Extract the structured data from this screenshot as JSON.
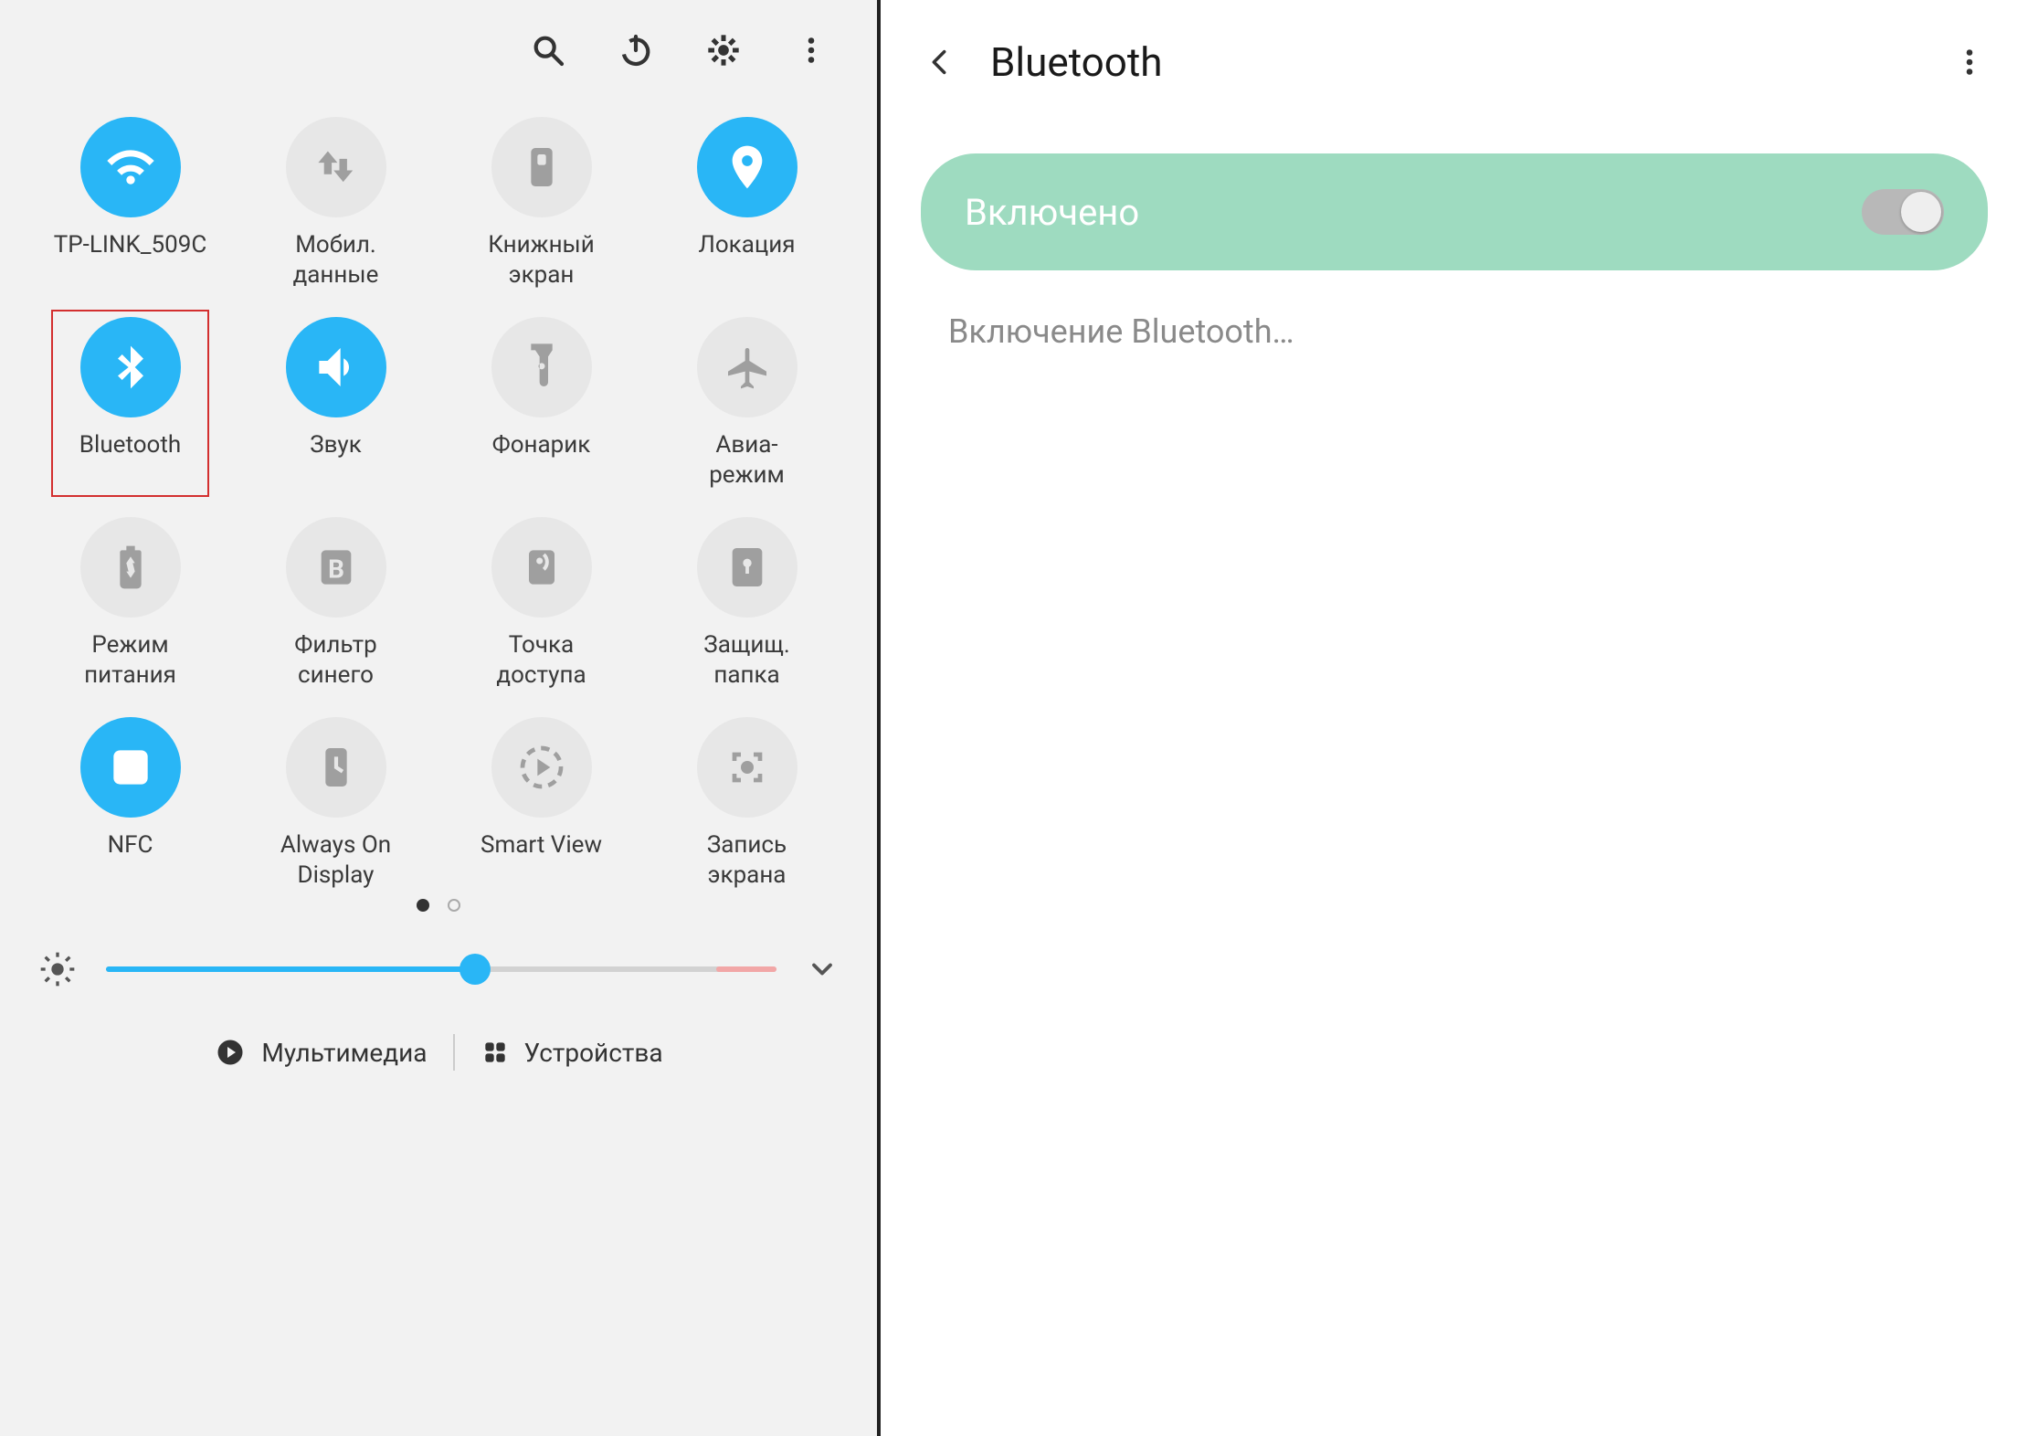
{
  "quick_settings": {
    "tiles": [
      {
        "label": "TP-LINK_509C",
        "icon": "wifi-icon",
        "active": true,
        "highlight": false
      },
      {
        "label": "Мобил.\nданные",
        "icon": "mobile-data-icon",
        "active": false,
        "highlight": false
      },
      {
        "label": "Книжный\nэкран",
        "icon": "book-screen-icon",
        "active": false,
        "highlight": false
      },
      {
        "label": "Локация",
        "icon": "location-icon",
        "active": true,
        "highlight": false
      },
      {
        "label": "Bluetooth",
        "icon": "bluetooth-icon",
        "active": true,
        "highlight": true
      },
      {
        "label": "Звук",
        "icon": "sound-icon",
        "active": true,
        "highlight": false
      },
      {
        "label": "Фонарик",
        "icon": "flashlight-icon",
        "active": false,
        "highlight": false
      },
      {
        "label": "Авиа-\nрежим",
        "icon": "airplane-icon",
        "active": false,
        "highlight": false
      },
      {
        "label": "Режим\nпитания",
        "icon": "battery-saver-icon",
        "active": false,
        "highlight": false
      },
      {
        "label": "Фильтр\nсинего",
        "icon": "blue-light-icon",
        "active": false,
        "highlight": false
      },
      {
        "label": "Точка\nдоступа",
        "icon": "hotspot-icon",
        "active": false,
        "highlight": false
      },
      {
        "label": "Защищ.\nпапка",
        "icon": "secure-folder-icon",
        "active": false,
        "highlight": false
      },
      {
        "label": "NFC",
        "icon": "nfc-icon",
        "active": true,
        "highlight": false
      },
      {
        "label": "Always On\nDisplay",
        "icon": "aod-icon",
        "active": false,
        "highlight": false
      },
      {
        "label": "Smart View",
        "icon": "smart-view-icon",
        "active": false,
        "highlight": false
      },
      {
        "label": "Запись\nэкрана",
        "icon": "screen-record-icon",
        "active": false,
        "highlight": false
      }
    ],
    "brightness_percent": 55,
    "footer": {
      "media_label": "Мультимедиа",
      "devices_label": "Устройства"
    }
  },
  "bluetooth_page": {
    "title": "Bluetooth",
    "toggle_label": "Включено",
    "toggle_on": true,
    "status_text": "Включение Bluetooth…"
  }
}
